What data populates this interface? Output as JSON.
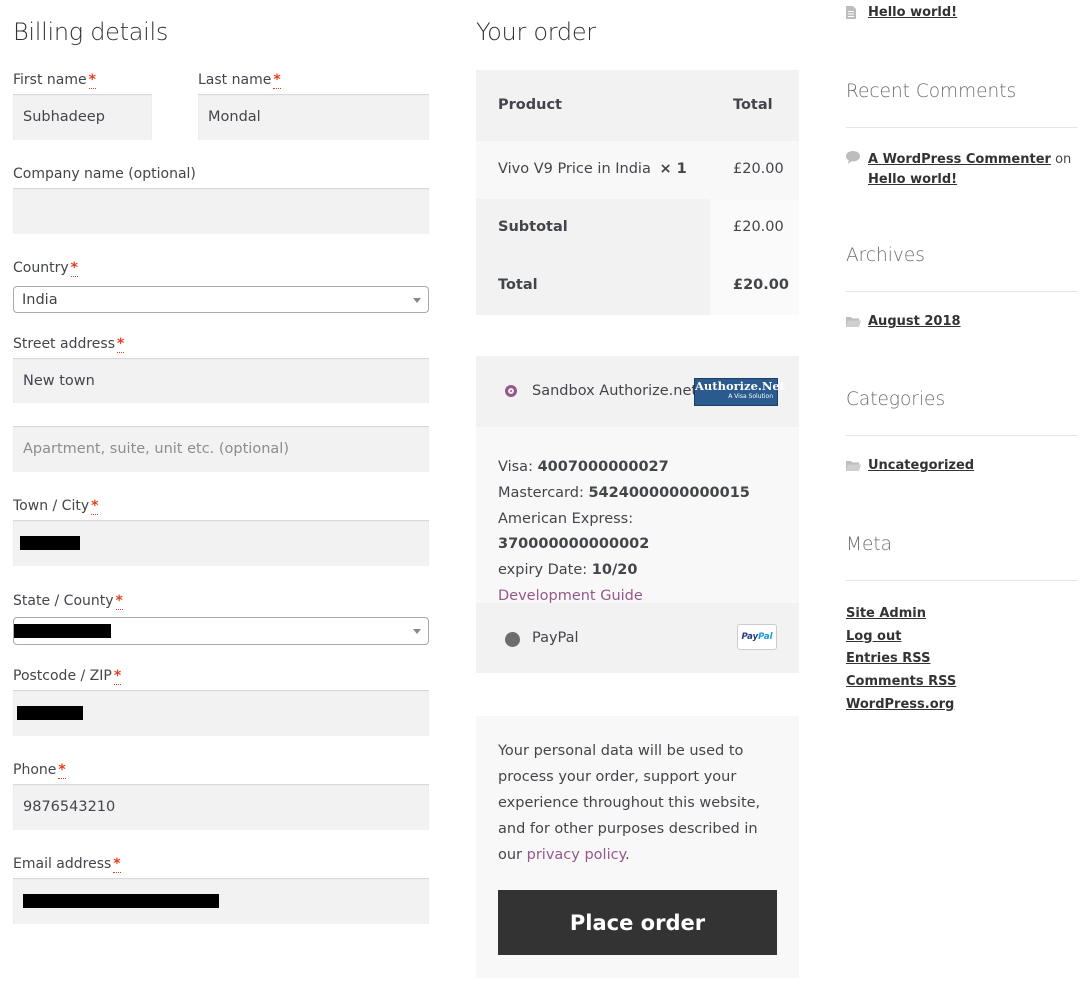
{
  "billing": {
    "title": "Billing details",
    "required_mark": "*",
    "first_name": {
      "label": "First name",
      "value": "Subhadeep"
    },
    "last_name": {
      "label": "Last name",
      "value": "Mondal"
    },
    "company": {
      "label": "Company name (optional)",
      "value": ""
    },
    "country": {
      "label": "Country",
      "value": "India"
    },
    "street": {
      "label": "Street address",
      "value": "New town",
      "apartment_placeholder": "Apartment, suite, unit etc. (optional)"
    },
    "city": {
      "label": "Town / City"
    },
    "state": {
      "label": "State / County"
    },
    "postcode": {
      "label": "Postcode / ZIP"
    },
    "phone": {
      "label": "Phone",
      "value": "9876543210"
    },
    "email": {
      "label": "Email address"
    }
  },
  "order": {
    "title": "Your order",
    "col_product": "Product",
    "col_total": "Total",
    "item_name": "Vivo V9 Price in India",
    "item_qty": "× 1",
    "item_total": "£20.00",
    "subtotal_label": "Subtotal",
    "subtotal_value": "£20.00",
    "total_label": "Total",
    "total_value": "£20.00"
  },
  "payment": {
    "authorize": {
      "label": "Sandbox Authorize.net",
      "logo_main": "Authorize.Net",
      "logo_sub": "A Visa Solution",
      "selected": true,
      "lines": [
        {
          "label": "Visa:",
          "value": "4007000000027"
        },
        {
          "label": "Mastercard:",
          "value": "5424000000000015"
        },
        {
          "label": "American Express:",
          "value": "370000000000002"
        },
        {
          "label": "expiry Date:",
          "value": "10/20"
        }
      ],
      "guide_link": "Development Guide"
    },
    "paypal": {
      "label": "PayPal",
      "logo_pay": "Pay",
      "logo_pal": "Pal",
      "selected": false
    }
  },
  "privacy": {
    "text": "Your personal data will be used to process your order, support your experience throughout this website, and for other purposes described in our",
    "link": "privacy policy",
    "end": "."
  },
  "place_order_label": "Place order",
  "sidebar": {
    "top_post": "Hello world!",
    "recent_comments": {
      "title": "Recent Comments",
      "author": "A WordPress Commenter",
      "on": "on",
      "post": "Hello world!"
    },
    "archives": {
      "title": "Archives",
      "item": "August 2018"
    },
    "categories": {
      "title": "Categories",
      "item": "Uncategorized"
    },
    "meta": {
      "title": "Meta",
      "links": [
        "Site Admin",
        "Log out",
        "Entries RSS",
        "Comments RSS",
        "WordPress.org"
      ]
    }
  },
  "colors": {
    "accent_purple": "#96588a",
    "required_red": "#e2401c",
    "button_dark": "#333333",
    "field_bg": "#f2f2f2"
  },
  "icons": {
    "post": "document-icon",
    "comment": "speech-bubble-icon",
    "archive": "folder-icon",
    "category": "folder-icon"
  }
}
